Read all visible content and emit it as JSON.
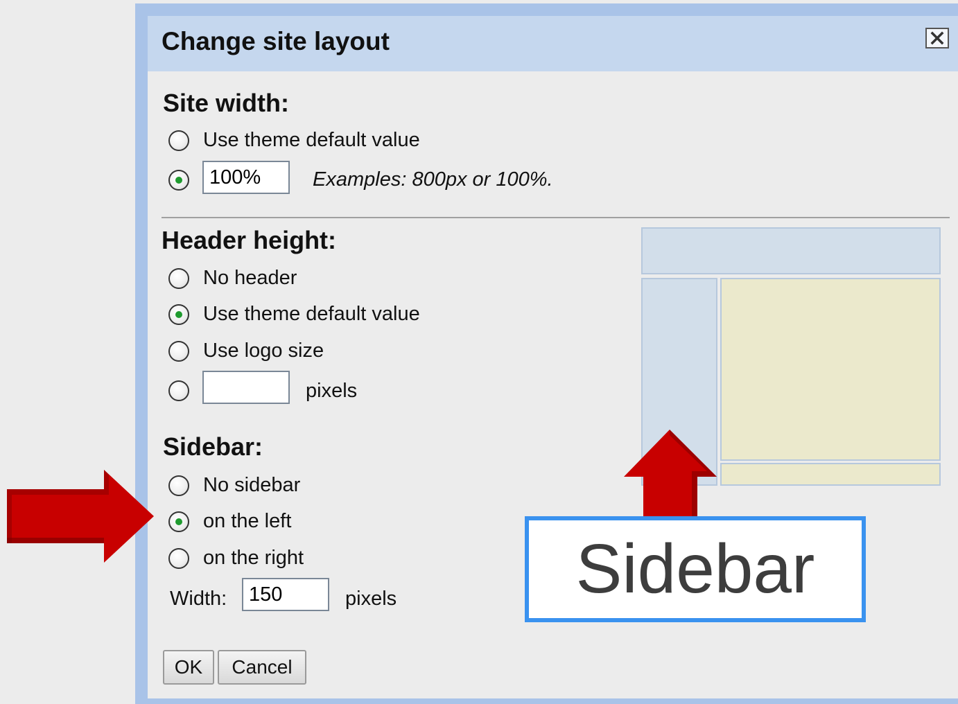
{
  "dialog": {
    "title": "Change site layout",
    "close_icon": "close-x-icon"
  },
  "site_width": {
    "heading": "Site width:",
    "option_default_label": "Use theme default value",
    "option_default_checked": false,
    "option_custom_checked": true,
    "custom_value": "100%",
    "examples_hint": "Examples: 800px or 100%."
  },
  "header_height": {
    "heading": "Header height:",
    "options": [
      {
        "label": "No header",
        "checked": false
      },
      {
        "label": "Use theme default value",
        "checked": true
      },
      {
        "label": "Use logo size",
        "checked": false
      }
    ],
    "custom_checked": false,
    "custom_value": "",
    "units_label": "pixels"
  },
  "sidebar": {
    "heading": "Sidebar:",
    "options": [
      {
        "label": "No sidebar",
        "checked": false
      },
      {
        "label": "on the left",
        "checked": true
      },
      {
        "label": "on the right",
        "checked": false
      }
    ],
    "width_label": "Width:",
    "width_value": "150",
    "units_label": "pixels"
  },
  "buttons": {
    "ok_label": "OK",
    "cancel_label": "Cancel"
  },
  "annotation": {
    "callout_text": "Sidebar",
    "arrow_color": "#c80000",
    "callout_border_color": "#3a92ef"
  },
  "layout_preview": {
    "header_color": "#d2deea",
    "sidebar_color": "#d2deea",
    "content_color": "#ebe9cc"
  }
}
